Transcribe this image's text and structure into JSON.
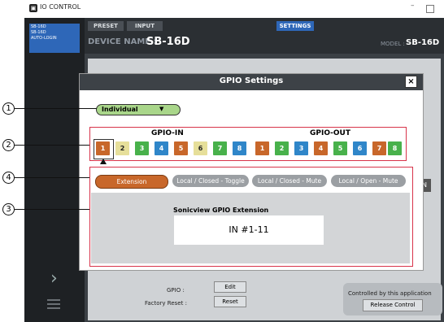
{
  "app": {
    "title": "IO CONTROL",
    "window_min": "–"
  },
  "sidebar": {
    "device_lines": [
      "SB-16D",
      "SB-16D",
      "",
      "AUTO-LOGIN"
    ]
  },
  "header": {
    "tabs": [
      "PRESET",
      "INPUT",
      "SETTINGS"
    ],
    "device_name_label": "DEVICE NAME :",
    "device_name": "SB-16D",
    "model_label": "MODEL :",
    "model": "SB-16D"
  },
  "main": {
    "gpio_label": "GPIO :",
    "gpio_edit": "Edit",
    "factory_reset_label": "Factory Reset :",
    "reset_button": "Reset",
    "controlled_text": "Controlled by this application",
    "release_button": "Release Control",
    "behind_button": "N"
  },
  "dialog": {
    "title": "GPIO Settings",
    "close": "×",
    "mode_select": "Individual",
    "gpio_in_label": "GPIO-IN",
    "gpio_out_label": "GPIO-OUT",
    "gpio_in": [
      "1",
      "2",
      "3",
      "4",
      "5",
      "6",
      "7",
      "8"
    ],
    "gpio_out": [
      "1",
      "2",
      "3",
      "4",
      "5",
      "6",
      "7",
      "8"
    ],
    "pin_colors": {
      "1": "#c8672a",
      "2": "#e6df9a",
      "3": "#48b14b",
      "4": "#2f86c9",
      "5": "#c8672a",
      "6": "#e6df9a",
      "7": "#48b14b",
      "8": "#2f86c9"
    },
    "selected_pin": "GPIO-IN 1",
    "segments": [
      "Extension",
      "Local / Closed - Toggle",
      "Local / Closed - Mute",
      "Local / Open - Mute"
    ],
    "active_segment": "Extension",
    "content_title": "Sonicview GPIO Extension",
    "content_value": "IN #1-11"
  },
  "callouts": [
    "1",
    "2",
    "3",
    "4"
  ],
  "colors": {
    "accent": "#c8672a",
    "dialog_header": "#3d4247",
    "highlight_border": "#d8344a"
  }
}
